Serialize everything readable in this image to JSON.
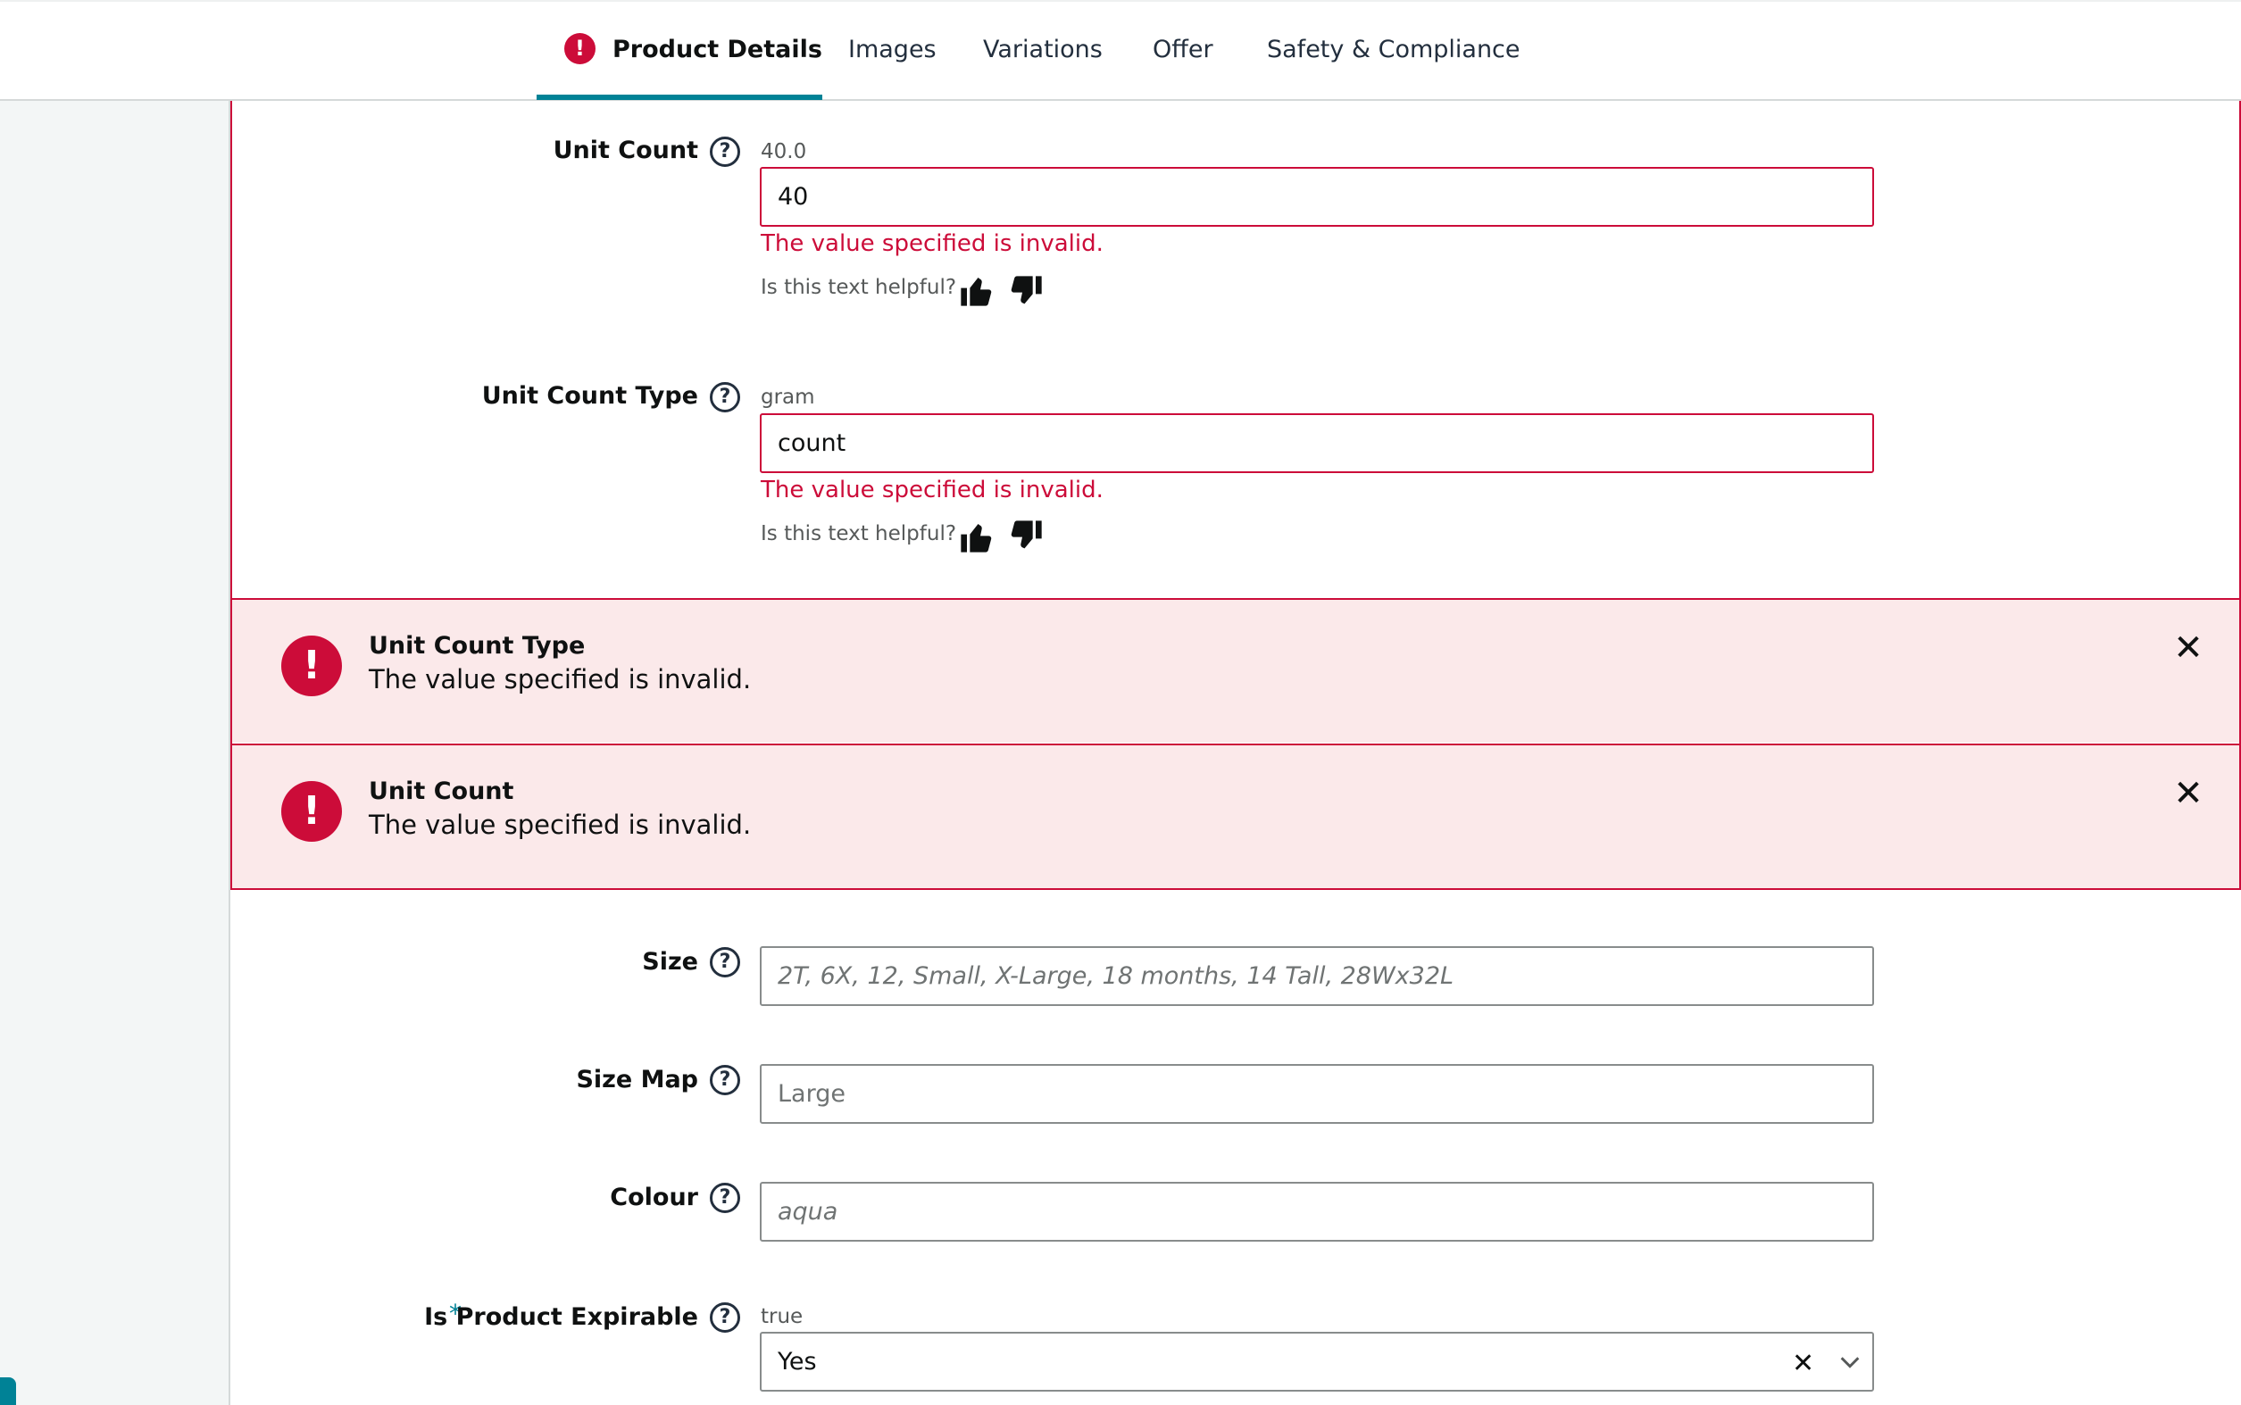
{
  "tabs": [
    {
      "label": "Product Details",
      "active": true,
      "has_error": true
    },
    {
      "label": "Images"
    },
    {
      "label": "Variations"
    },
    {
      "label": "Offer"
    },
    {
      "label": "Safety & Compliance"
    }
  ],
  "fields": {
    "unit_count": {
      "label": "Unit Count",
      "original_value": "40.0",
      "value": "40",
      "error": "The value specified is invalid.",
      "helpful_prompt": "Is this text helpful?"
    },
    "unit_count_type": {
      "label": "Unit Count Type",
      "original_value": "gram",
      "value": "count",
      "error": "The value specified is invalid.",
      "helpful_prompt": "Is this text helpful?"
    },
    "size": {
      "label": "Size",
      "placeholder": "2T, 6X, 12, Small, X-Large, 18 months, 14 Tall, 28Wx32L"
    },
    "size_map": {
      "label": "Size Map",
      "placeholder": "Large"
    },
    "colour": {
      "label": "Colour",
      "placeholder": "aqua"
    },
    "is_product_expirable": {
      "label": "Is Product Expirable",
      "required_mark": "*",
      "original_value": "true",
      "selected": "Yes"
    }
  },
  "banners": [
    {
      "title": "Unit Count Type",
      "message": "The value specified is invalid."
    },
    {
      "title": "Unit Count",
      "message": "The value specified is invalid."
    }
  ],
  "icons": {
    "help": "?",
    "error": "!",
    "close": "✕",
    "clear": "✕"
  },
  "colors": {
    "accent": "#008296",
    "error": "#cc0c39",
    "error_bg": "#fbe9ea"
  }
}
